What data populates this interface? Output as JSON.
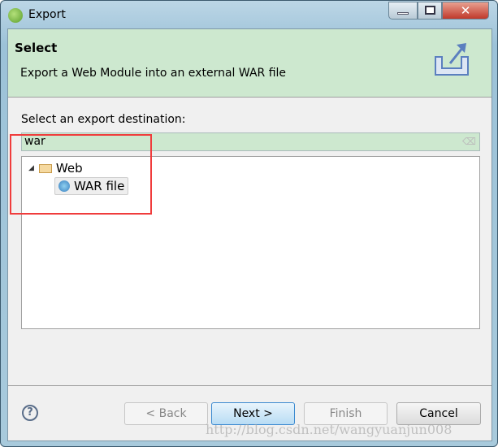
{
  "window": {
    "title": "Export"
  },
  "header": {
    "title": "Select",
    "description": "Export a Web Module into an external WAR file"
  },
  "main": {
    "label": "Select an export destination:",
    "filter_value": "war",
    "tree": [
      {
        "label": "Web",
        "expanded": true,
        "children": [
          {
            "label": "WAR file",
            "selected": true
          }
        ]
      }
    ]
  },
  "buttons": {
    "back": "< Back",
    "next": "Next >",
    "finish": "Finish",
    "cancel": "Cancel"
  },
  "watermark": "http://blog.csdn.net/wangyuanjun008",
  "colors": {
    "header_bg": "#cde8cf",
    "highlight": "#f03c3c"
  }
}
